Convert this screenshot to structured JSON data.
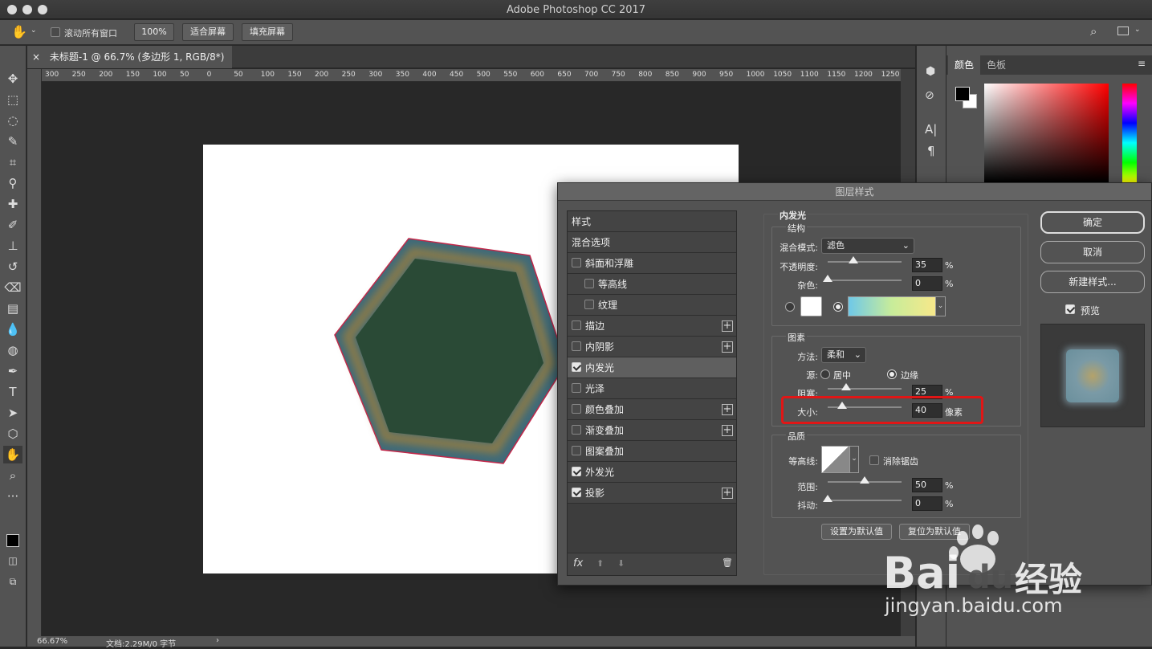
{
  "app": {
    "title": "Adobe Photoshop CC 2017"
  },
  "options": {
    "scroll_all_label": "滚动所有窗口",
    "zoom_label": "100%",
    "fit_screen_label": "适合屏幕",
    "fill_screen_label": "填充屏幕"
  },
  "document": {
    "tab_title": "未标题-1 @ 66.7% (多边形 1, RGB/8*) *",
    "close_glyph": "×"
  },
  "ruler_h": [
    "300",
    "250",
    "200",
    "150",
    "100",
    "50",
    "0",
    "50",
    "100",
    "150",
    "200",
    "250",
    "300",
    "350",
    "400",
    "450",
    "500",
    "550",
    "600",
    "650",
    "700",
    "750",
    "800",
    "850",
    "900",
    "950",
    "1000",
    "1050",
    "1100",
    "1150",
    "1200",
    "1250"
  ],
  "status": {
    "zoom": "66.67%",
    "doc_info": "文档:2.29M/0 字节",
    "arrow": "›"
  },
  "color_panel": {
    "tab_color": "颜色",
    "tab_swatches": "色板"
  },
  "panel_icons": {
    "char_label": "A|",
    "para_label": "¶"
  },
  "dialog": {
    "title": "图层样式",
    "styles": [
      {
        "label": "样式",
        "checkbox": false,
        "checked": false,
        "plus": false,
        "indent": false,
        "selected": false
      },
      {
        "label": "混合选项",
        "checkbox": false,
        "checked": false,
        "plus": false,
        "indent": false,
        "selected": false
      },
      {
        "label": "斜面和浮雕",
        "checkbox": true,
        "checked": false,
        "plus": false,
        "indent": false,
        "selected": false
      },
      {
        "label": "等高线",
        "checkbox": true,
        "checked": false,
        "plus": false,
        "indent": true,
        "selected": false
      },
      {
        "label": "纹理",
        "checkbox": true,
        "checked": false,
        "plus": false,
        "indent": true,
        "selected": false
      },
      {
        "label": "描边",
        "checkbox": true,
        "checked": false,
        "plus": true,
        "indent": false,
        "selected": false
      },
      {
        "label": "内阴影",
        "checkbox": true,
        "checked": false,
        "plus": true,
        "indent": false,
        "selected": false
      },
      {
        "label": "内发光",
        "checkbox": true,
        "checked": true,
        "plus": false,
        "indent": false,
        "selected": true
      },
      {
        "label": "光泽",
        "checkbox": true,
        "checked": false,
        "plus": false,
        "indent": false,
        "selected": false
      },
      {
        "label": "颜色叠加",
        "checkbox": true,
        "checked": false,
        "plus": true,
        "indent": false,
        "selected": false
      },
      {
        "label": "渐变叠加",
        "checkbox": true,
        "checked": false,
        "plus": true,
        "indent": false,
        "selected": false
      },
      {
        "label": "图案叠加",
        "checkbox": true,
        "checked": false,
        "plus": false,
        "indent": false,
        "selected": false
      },
      {
        "label": "外发光",
        "checkbox": true,
        "checked": true,
        "plus": false,
        "indent": false,
        "selected": false
      },
      {
        "label": "投影",
        "checkbox": true,
        "checked": true,
        "plus": true,
        "indent": false,
        "selected": false
      }
    ],
    "footer": {
      "fx": "fx",
      "up": "⬆",
      "down": "⬇",
      "trash": "🗑"
    },
    "inner_glow": {
      "section_title": "内发光",
      "structure_title": "结构",
      "blend_mode_label": "混合模式:",
      "blend_mode_value": "滤色",
      "opacity_label": "不透明度:",
      "opacity_value": "35",
      "opacity_unit": "%",
      "opacity_fraction": 0.35,
      "noise_label": "杂色:",
      "noise_value": "0",
      "noise_unit": "%",
      "noise_fraction": 0.0,
      "elements_title": "图素",
      "method_label": "方法:",
      "method_value": "柔和",
      "source_label": "源:",
      "source_center": "居中",
      "source_edge": "边缘",
      "choke_label": "阻塞:",
      "choke_value": "25",
      "choke_unit": "%",
      "choke_fraction": 0.25,
      "size_label": "大小:",
      "size_value": "40",
      "size_unit": "像素",
      "size_fraction": 0.2,
      "quality_title": "品质",
      "contour_label": "等高线:",
      "antialias_label": "消除锯齿",
      "range_label": "范围:",
      "range_value": "50",
      "range_unit": "%",
      "range_fraction": 0.5,
      "jitter_label": "抖动:",
      "jitter_value": "0",
      "jitter_unit": "%",
      "jitter_fraction": 0.0,
      "set_default_label": "设置为默认值",
      "reset_default_label": "复位为默认值"
    },
    "buttons": {
      "ok": "确定",
      "cancel": "取消",
      "new_style": "新建样式...",
      "preview": "预览"
    }
  },
  "watermark": {
    "brand": "Bai",
    "brand2": "du",
    "product": "经验",
    "url": "jingyan.baidu.com"
  },
  "colors": {
    "accent_red": "#e01616",
    "hex_fill": "#2a4a36",
    "hex_edge": "#3f6a78",
    "glow": "#8a7a4a"
  }
}
